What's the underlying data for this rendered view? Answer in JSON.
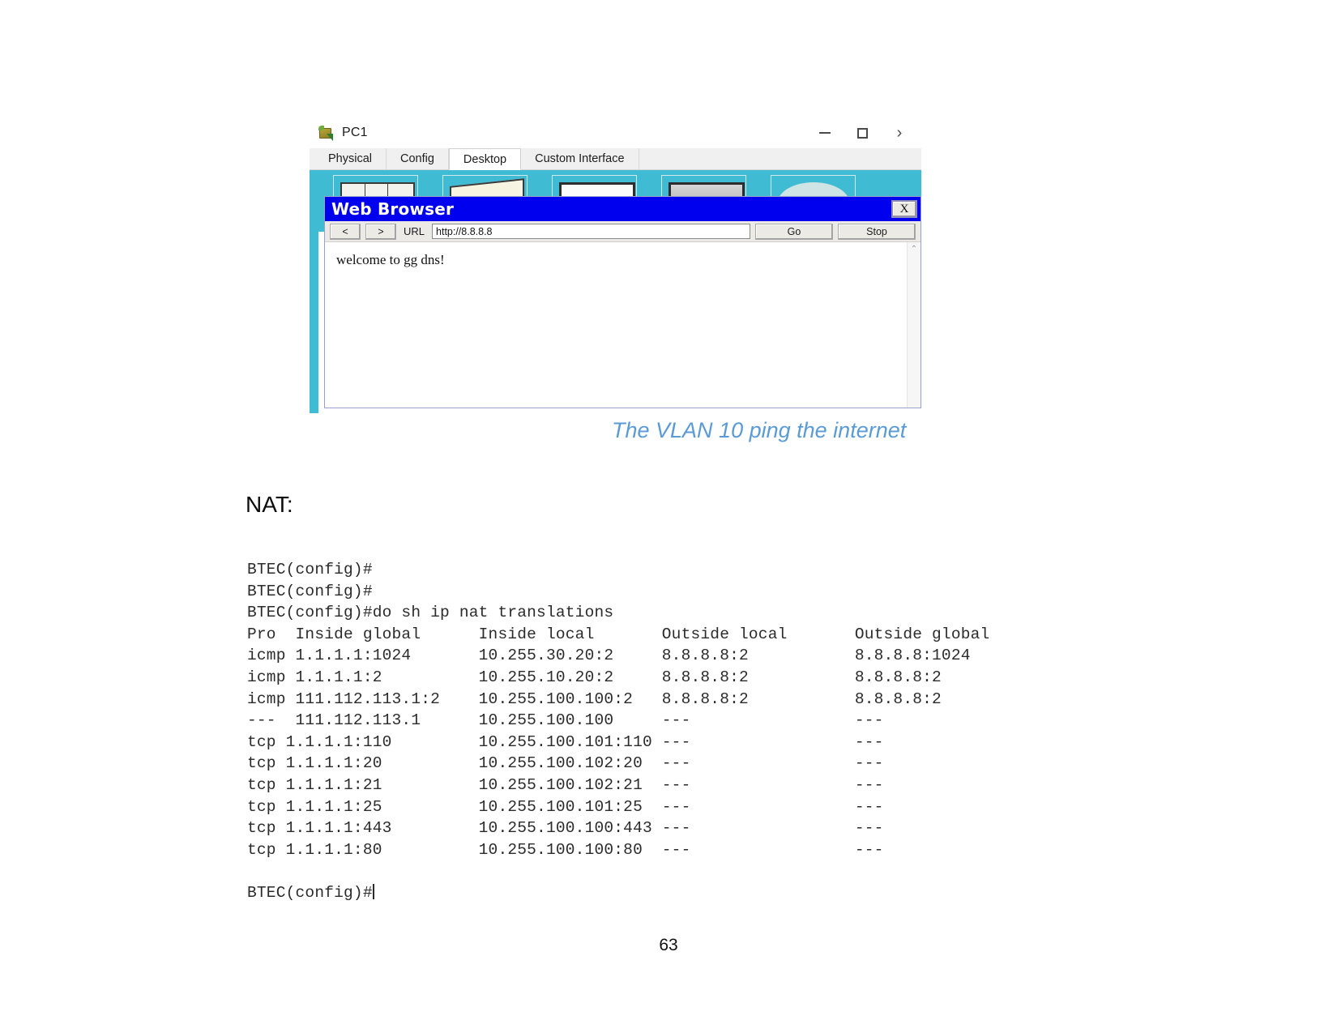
{
  "document": {
    "page_number": "63",
    "nat_section_label": "NAT:",
    "figure_caption": "The VLAN 10 ping the internet"
  },
  "pc_window": {
    "title": "PC1",
    "title_icon": "packet-tracer-pc-icon",
    "window_controls": {
      "minimize": "—",
      "maximize": "☐",
      "close": "›"
    },
    "tabs": [
      {
        "label": "Physical",
        "active": false
      },
      {
        "label": "Config",
        "active": false
      },
      {
        "label": "Desktop",
        "active": true
      },
      {
        "label": "Custom Interface",
        "active": false
      }
    ],
    "desktop_icons": [
      {
        "name": "ip-configuration-icon"
      },
      {
        "name": "dial-up-icon"
      },
      {
        "name": "terminal-icon"
      },
      {
        "name": "command-prompt-icon"
      },
      {
        "name": "web-browser-icon"
      }
    ]
  },
  "web_browser": {
    "title": "Web Browser",
    "close_label": "X",
    "back_label": "<",
    "forward_label": ">",
    "url_label": "URL",
    "url_value": "http://8.8.8.8",
    "url_placeholder": "http://",
    "go_label": "Go",
    "stop_label": "Stop",
    "page_content": "welcome to gg dns!",
    "scroll_up_glyph": "⌃"
  },
  "terminal": {
    "lines": [
      "BTEC(config)#",
      "BTEC(config)#",
      "BTEC(config)#do sh ip nat translations",
      "Pro  Inside global      Inside local       Outside local       Outside global",
      "icmp 1.1.1.1:1024       10.255.30.20:2     8.8.8.8:2           8.8.8.8:1024",
      "icmp 1.1.1.1:2          10.255.10.20:2     8.8.8.8:2           8.8.8.8:2",
      "icmp 111.112.113.1:2    10.255.100.100:2   8.8.8.8:2           8.8.8.8:2",
      "---  111.112.113.1      10.255.100.100     ---                 ---",
      "tcp 1.1.1.1:110         10.255.100.101:110 ---                 ---",
      "tcp 1.1.1.1:20          10.255.100.102:20  ---                 ---",
      "tcp 1.1.1.1:21          10.255.100.102:21  ---                 ---",
      "tcp 1.1.1.1:25          10.255.100.101:25  ---                 ---",
      "tcp 1.1.1.1:443         10.255.100.100:443 ---                 ---",
      "tcp 1.1.1.1:80          10.255.100.100:80  ---                 ---"
    ],
    "prompt_after": "BTEC(config)#",
    "columns": [
      "Pro",
      "Inside global",
      "Inside local",
      "Outside local",
      "Outside global"
    ],
    "rows": [
      {
        "pro": "icmp",
        "inside_global": "1.1.1.1:1024",
        "inside_local": "10.255.30.20:2",
        "outside_local": "8.8.8.8:2",
        "outside_global": "8.8.8.8:1024"
      },
      {
        "pro": "icmp",
        "inside_global": "1.1.1.1:2",
        "inside_local": "10.255.10.20:2",
        "outside_local": "8.8.8.8:2",
        "outside_global": "8.8.8.8:2"
      },
      {
        "pro": "icmp",
        "inside_global": "111.112.113.1:2",
        "inside_local": "10.255.100.100:2",
        "outside_local": "8.8.8.8:2",
        "outside_global": "8.8.8.8:2"
      },
      {
        "pro": "---",
        "inside_global": "111.112.113.1",
        "inside_local": "10.255.100.100",
        "outside_local": "---",
        "outside_global": "---"
      },
      {
        "pro": "tcp",
        "inside_global": "1.1.1.1:110",
        "inside_local": "10.255.100.101:110",
        "outside_local": "---",
        "outside_global": "---"
      },
      {
        "pro": "tcp",
        "inside_global": "1.1.1.1:20",
        "inside_local": "10.255.100.102:20",
        "outside_local": "---",
        "outside_global": "---"
      },
      {
        "pro": "tcp",
        "inside_global": "1.1.1.1:21",
        "inside_local": "10.255.100.102:21",
        "outside_local": "---",
        "outside_global": "---"
      },
      {
        "pro": "tcp",
        "inside_global": "1.1.1.1:25",
        "inside_local": "10.255.100.101:25",
        "outside_local": "---",
        "outside_global": "---"
      },
      {
        "pro": "tcp",
        "inside_global": "1.1.1.1:443",
        "inside_local": "10.255.100.100:443",
        "outside_local": "---",
        "outside_global": "---"
      },
      {
        "pro": "tcp",
        "inside_global": "1.1.1.1:80",
        "inside_local": "10.255.100.100:80",
        "outside_local": "---",
        "outside_global": "---"
      }
    ]
  },
  "colors": {
    "caption_blue": "#5b9bd5",
    "browser_titlebar_blue": "#0000ee",
    "desktop_teal": "#3fbcd4"
  }
}
